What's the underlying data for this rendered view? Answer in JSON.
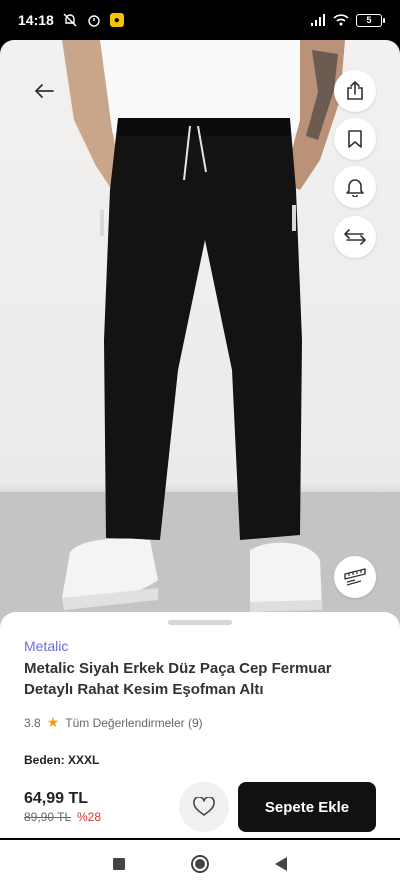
{
  "status_bar": {
    "time": "14:18",
    "battery": "5",
    "notification_badge": "●"
  },
  "product": {
    "brand": "Metalic",
    "title": "Metalic Siyah Erkek Düz Paça Cep Fermuar Detaylı Rahat Kesim Eşofman Altı",
    "rating": "3.8",
    "reviews_label": "Tüm Değerlendirmeler (9)",
    "size_label": "Beden: XXXL",
    "price": "64,99 TL",
    "old_price": "89,90 TL",
    "discount": "%28"
  },
  "actions": {
    "add_to_cart": "Sepete Ekle"
  },
  "icons": {
    "back": "arrow-left-icon",
    "share": "share-icon",
    "bookmark": "bookmark-icon",
    "alert": "bell-icon",
    "compare": "compare-arrows-icon",
    "size_guide": "ruler-icon",
    "favorite": "heart-icon"
  },
  "colors": {
    "brand": "#6a6ee0",
    "discount": "#d8322c",
    "cart_button": "#111111",
    "star": "#f39c12"
  }
}
